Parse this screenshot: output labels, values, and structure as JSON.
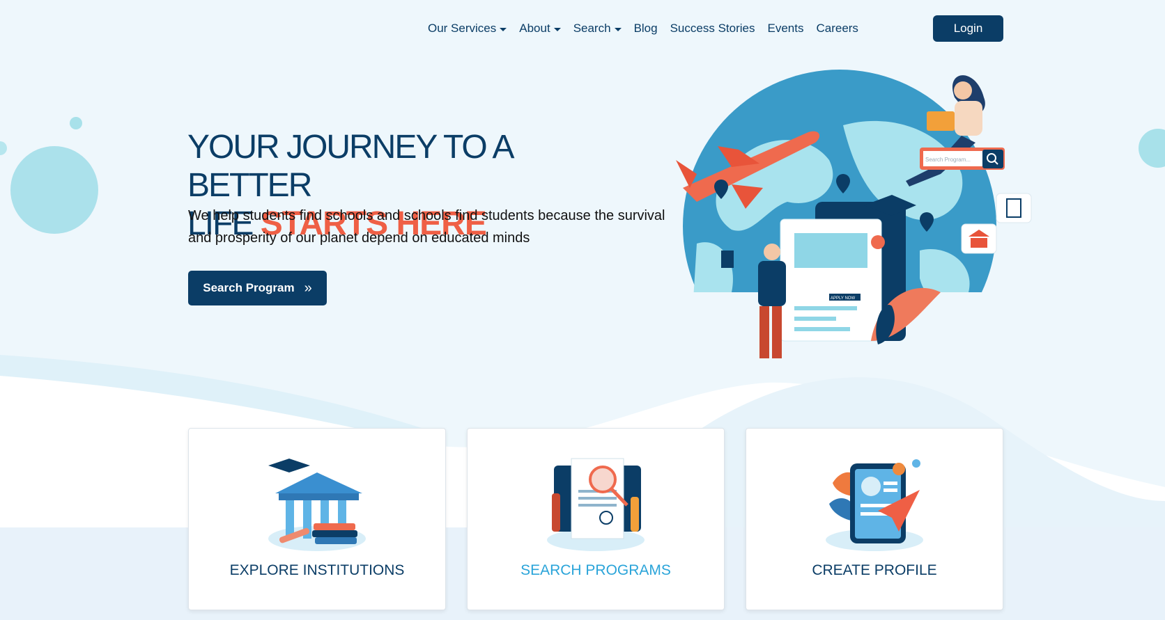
{
  "nav": {
    "items": [
      {
        "label": "Our Services",
        "dropdown": true
      },
      {
        "label": "About",
        "dropdown": true
      },
      {
        "label": "Search",
        "dropdown": true
      },
      {
        "label": "Blog",
        "dropdown": false
      },
      {
        "label": "Success Stories",
        "dropdown": false
      },
      {
        "label": "Events",
        "dropdown": false
      },
      {
        "label": "Careers",
        "dropdown": false
      }
    ],
    "login_label": "Login"
  },
  "hero": {
    "title_line1": "YOUR JOURNEY TO A BETTER",
    "title_line2_prefix": "LIFE ",
    "title_line2_accent": "STARTS HERE",
    "subtitle": "We help students find schools and schools find students because the survival and prosperity of our planet depend on educated minds",
    "cta_label": "Search Program",
    "illustration": {
      "search_placeholder": "Search Program...",
      "apply_badge": "APPLY NOW"
    }
  },
  "cards": [
    {
      "label": "EXPLORE INSTITUTIONS",
      "icon": "institution-icon"
    },
    {
      "label": "SEARCH PROGRAMS",
      "icon": "search-programs-icon",
      "active": true
    },
    {
      "label": "CREATE PROFILE",
      "icon": "profile-icon"
    }
  ],
  "colors": {
    "navy": "#0b3d66",
    "accent": "#ef5f45",
    "active_link": "#2aa4d9",
    "background": "#eef7fc"
  }
}
